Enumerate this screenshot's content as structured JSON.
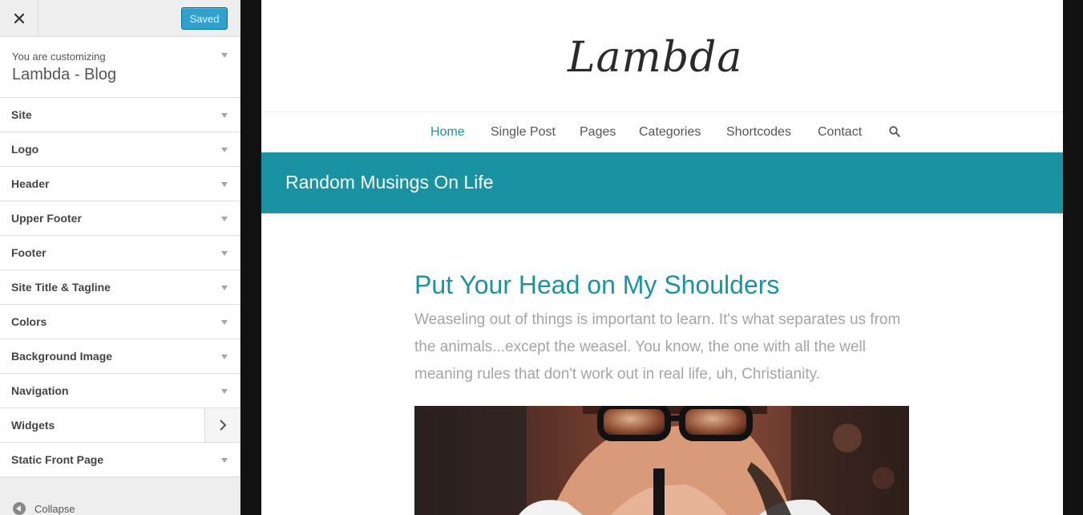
{
  "sidebar": {
    "close_icon": "close-icon",
    "save_label": "Saved",
    "customizing_pre": "You are customizing",
    "customizing_title": "Lambda - Blog",
    "sections": [
      {
        "label": "Site"
      },
      {
        "label": "Logo"
      },
      {
        "label": "Header"
      },
      {
        "label": "Upper Footer"
      },
      {
        "label": "Footer"
      },
      {
        "label": "Site Title & Tagline"
      },
      {
        "label": "Colors"
      },
      {
        "label": "Background Image"
      },
      {
        "label": "Navigation"
      },
      {
        "label": "Widgets"
      },
      {
        "label": "Static Front Page"
      }
    ],
    "collapse_label": "Collapse"
  },
  "preview": {
    "logo_text": "Lambda",
    "nav": [
      "Home",
      "Single Post",
      "Pages",
      "Categories",
      "Shortcodes",
      "Contact"
    ],
    "active_nav": "Home",
    "search_icon": "search-icon",
    "banner_title": "Random Musings On Life",
    "post_title": "Put Your Head on My Shoulders",
    "post_excerpt": "Weaseling out of things is important to learn. It's what separates us from the animals...except the weasel. You know, the one with all the well meaning rules that don't work out in real life, uh, Christianity.",
    "accent_color": "#1993a1",
    "button_color": "#2ea2cc"
  }
}
